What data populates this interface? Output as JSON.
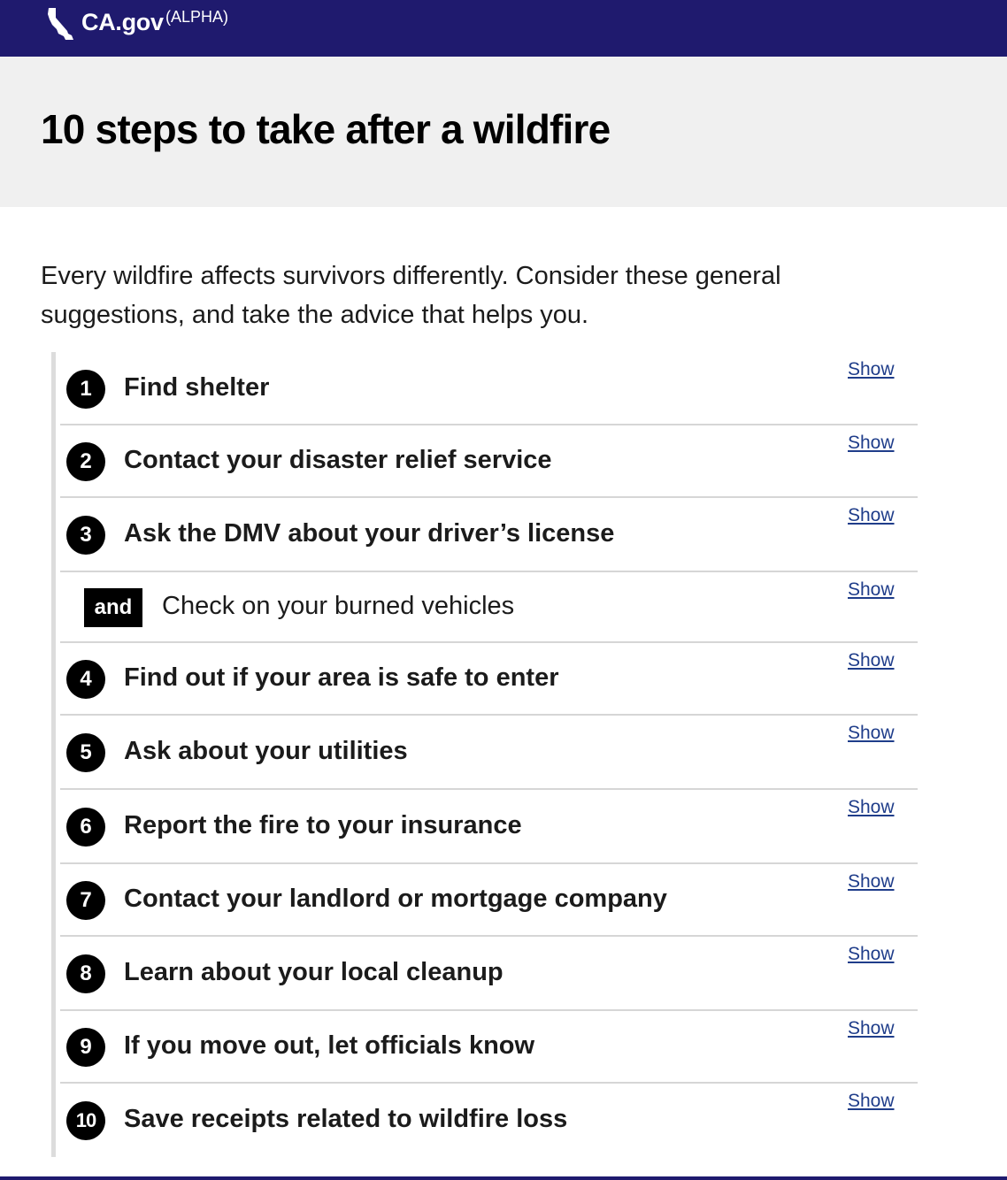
{
  "header": {
    "brand": "CA.gov",
    "badge": "(ALPHA)",
    "logo_icon": "california-state-icon",
    "bg_color": "#1f1a6e"
  },
  "page": {
    "title": "10 steps to take after a wildfire",
    "intro": "Every wildfire affects survivors differently. Consider these general suggestions, and take the advice that helps you."
  },
  "steps": [
    {
      "number": "1",
      "title": "Find shelter",
      "action": "Show"
    },
    {
      "number": "2",
      "title": "Contact your disaster relief service",
      "action": "Show"
    },
    {
      "number": "3",
      "title": "Ask the DMV about your driver’s license",
      "action": "Show"
    },
    {
      "number": "and",
      "title": "Check on your burned vehicles",
      "action": "Show"
    },
    {
      "number": "4",
      "title": "Find out if your area is safe to enter",
      "action": "Show"
    },
    {
      "number": "5",
      "title": "Ask about your utilities",
      "action": "Show"
    },
    {
      "number": "6",
      "title": "Report the fire to your insurance",
      "action": "Show"
    },
    {
      "number": "7",
      "title": "Contact your landlord or mortgage company",
      "action": "Show"
    },
    {
      "number": "8",
      "title": "Learn about your local cleanup",
      "action": "Show"
    },
    {
      "number": "9",
      "title": "If you move out, let officials know",
      "action": "Show"
    },
    {
      "number": "10",
      "title": "Save receipts related to wildfire loss",
      "action": "Show"
    }
  ]
}
